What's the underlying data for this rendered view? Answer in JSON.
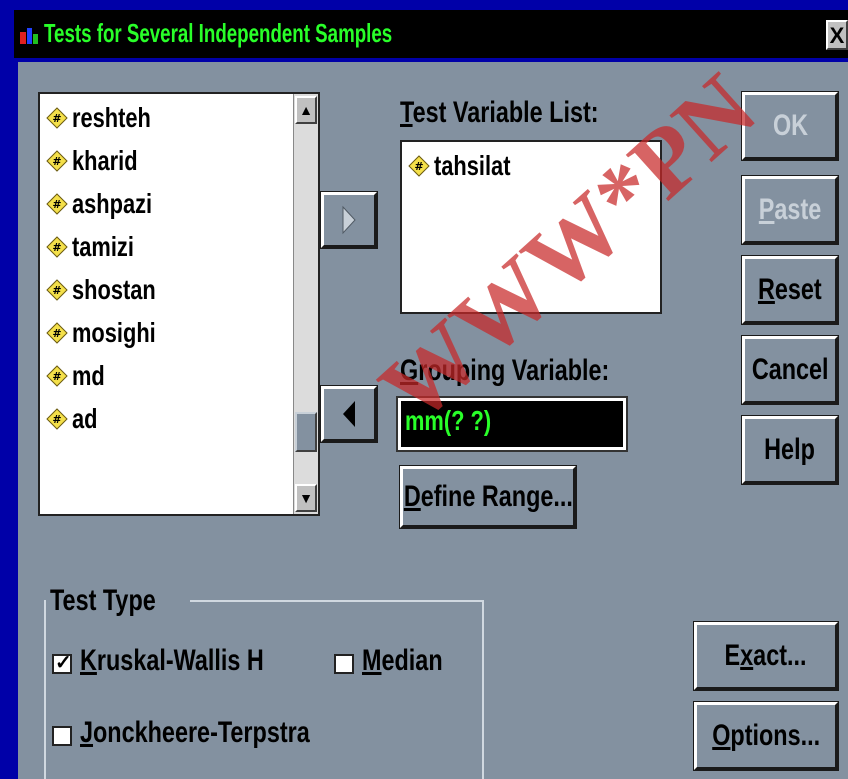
{
  "window": {
    "title": "Tests for Several Independent Samples",
    "close_glyph": "X"
  },
  "source_list": {
    "items": [
      {
        "label": "reshteh"
      },
      {
        "label": "kharid"
      },
      {
        "label": "ashpazi"
      },
      {
        "label": "tamizi"
      },
      {
        "label": "shostan"
      },
      {
        "label": "mosighi"
      },
      {
        "label": "md"
      },
      {
        "label": "ad"
      }
    ],
    "variable_icon": "numeric-variable-icon"
  },
  "test_variable_list": {
    "label_prefix": "T",
    "label_rest": "est Variable List:",
    "items": [
      {
        "label": "tahsilat"
      }
    ]
  },
  "grouping_variable": {
    "label_prefix": "G",
    "label_rest": "rouping Variable:",
    "value": "mm(? ?)"
  },
  "define_range": {
    "label_prefix": "D",
    "label_rest": "efine Range..."
  },
  "buttons": {
    "ok": "OK",
    "paste_prefix": "P",
    "paste_rest": "aste",
    "reset_prefix": "R",
    "reset_rest": "eset",
    "cancel": "Cancel",
    "help": "Help",
    "exact_pre": "E",
    "exact_u": "x",
    "exact_rest": "act...",
    "options_prefix": "O",
    "options_rest": "ptions..."
  },
  "test_type": {
    "legend": "Test Type",
    "kruskal": {
      "prefix": "K",
      "rest": "ruskal-Wallis H",
      "checked": true
    },
    "median": {
      "prefix": "M",
      "rest": "edian",
      "checked": false
    },
    "jonckheere": {
      "prefix": "J",
      "rest": "onckheere-Terpstra",
      "checked": false
    }
  },
  "watermark": "WWW*PN",
  "colors": {
    "title_text": "#29ff29",
    "dialog_bg": "#8391a0",
    "frame_blue": "#0000a8",
    "watermark": "#c82828"
  }
}
